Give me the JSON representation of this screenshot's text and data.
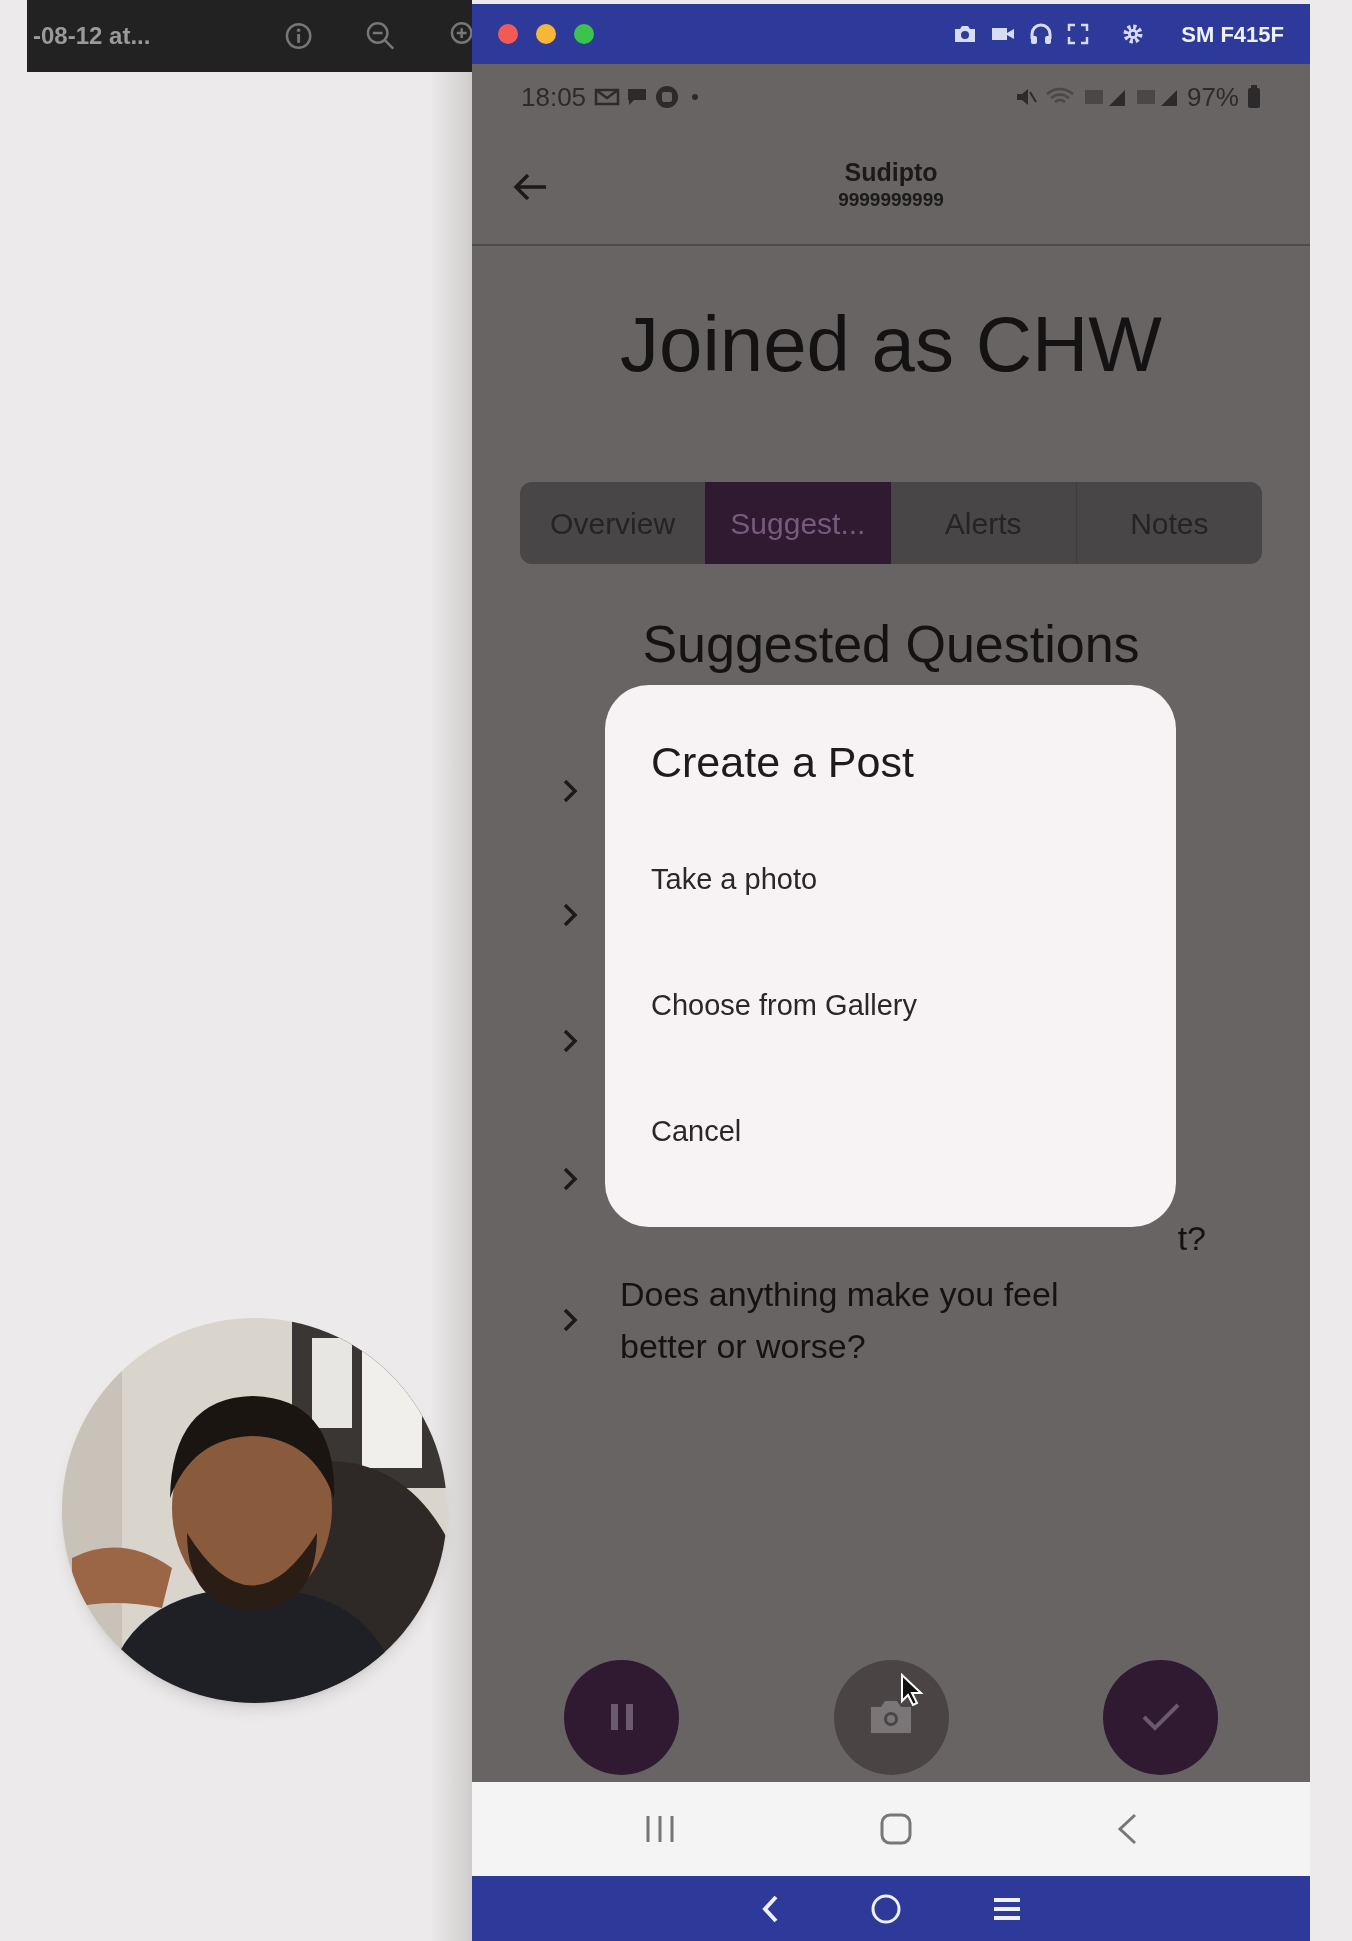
{
  "viewer_toolbar": {
    "title": "-08-12 at..."
  },
  "mirror_window": {
    "device_name": "SM F415F"
  },
  "status_bar": {
    "time": "18:05",
    "battery": "97%"
  },
  "app_bar": {
    "name": "Sudipto",
    "phone": "9999999999"
  },
  "heading": "Joined as CHW",
  "tabs": [
    {
      "label": "Overview",
      "selected": false
    },
    {
      "label": "Suggest...",
      "selected": true
    },
    {
      "label": "Alerts",
      "selected": false
    },
    {
      "label": "Notes",
      "selected": false
    }
  ],
  "section_title": "Suggested Questions",
  "questions": [
    {
      "kind": "covered"
    },
    {
      "kind": "covered"
    },
    {
      "kind": "covered"
    },
    {
      "kind": "partial",
      "text": "t?"
    },
    {
      "kind": "full",
      "text": "Does anything make you feel better or worse?"
    }
  ],
  "dialog": {
    "title": "Create a Post",
    "options": [
      "Take a photo",
      "Choose from Gallery",
      "Cancel"
    ]
  },
  "action_buttons": [
    {
      "kind": "pause"
    },
    {
      "kind": "camera"
    },
    {
      "kind": "check"
    }
  ]
}
